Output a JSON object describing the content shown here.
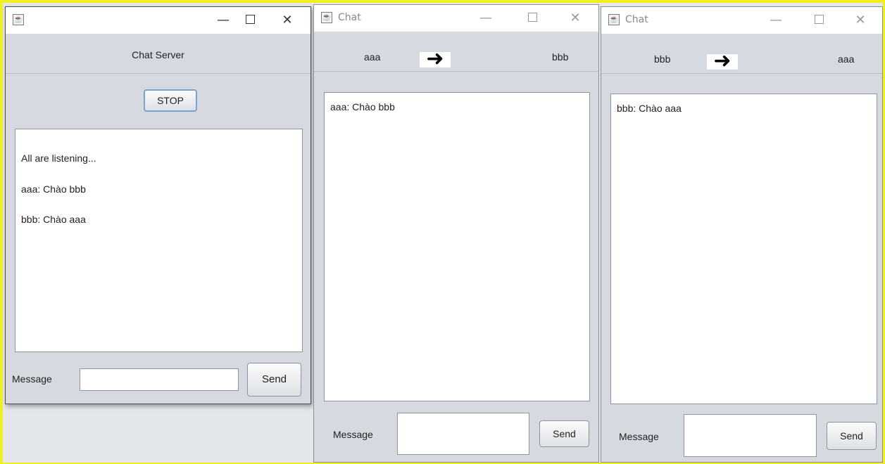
{
  "server": {
    "heading": "Chat Server",
    "stop_label": "STOP",
    "log_lines": [
      "All are listening...",
      "aaa: Chào bbb",
      "bbb: Chào aaa"
    ],
    "message_label": "Message",
    "message_value": "",
    "send_label": "Send"
  },
  "client_a": {
    "title": "Chat",
    "from": "aaa",
    "to": "bbb",
    "arrow": "➜",
    "messages": [
      "aaa: Chào bbb"
    ],
    "message_label": "Message",
    "message_value": "",
    "send_label": "Send"
  },
  "client_b": {
    "title": "Chat",
    "from": "bbb",
    "to": "aaa",
    "arrow": "➜",
    "messages": [
      "bbb: Chào aaa"
    ],
    "message_label": "Message",
    "message_value": "",
    "send_label": "Send"
  },
  "window_controls": {
    "minimize": "—",
    "close": "✕"
  },
  "icons": {
    "app": "java-coffee-icon",
    "arrow": "right-arrow-icon"
  }
}
